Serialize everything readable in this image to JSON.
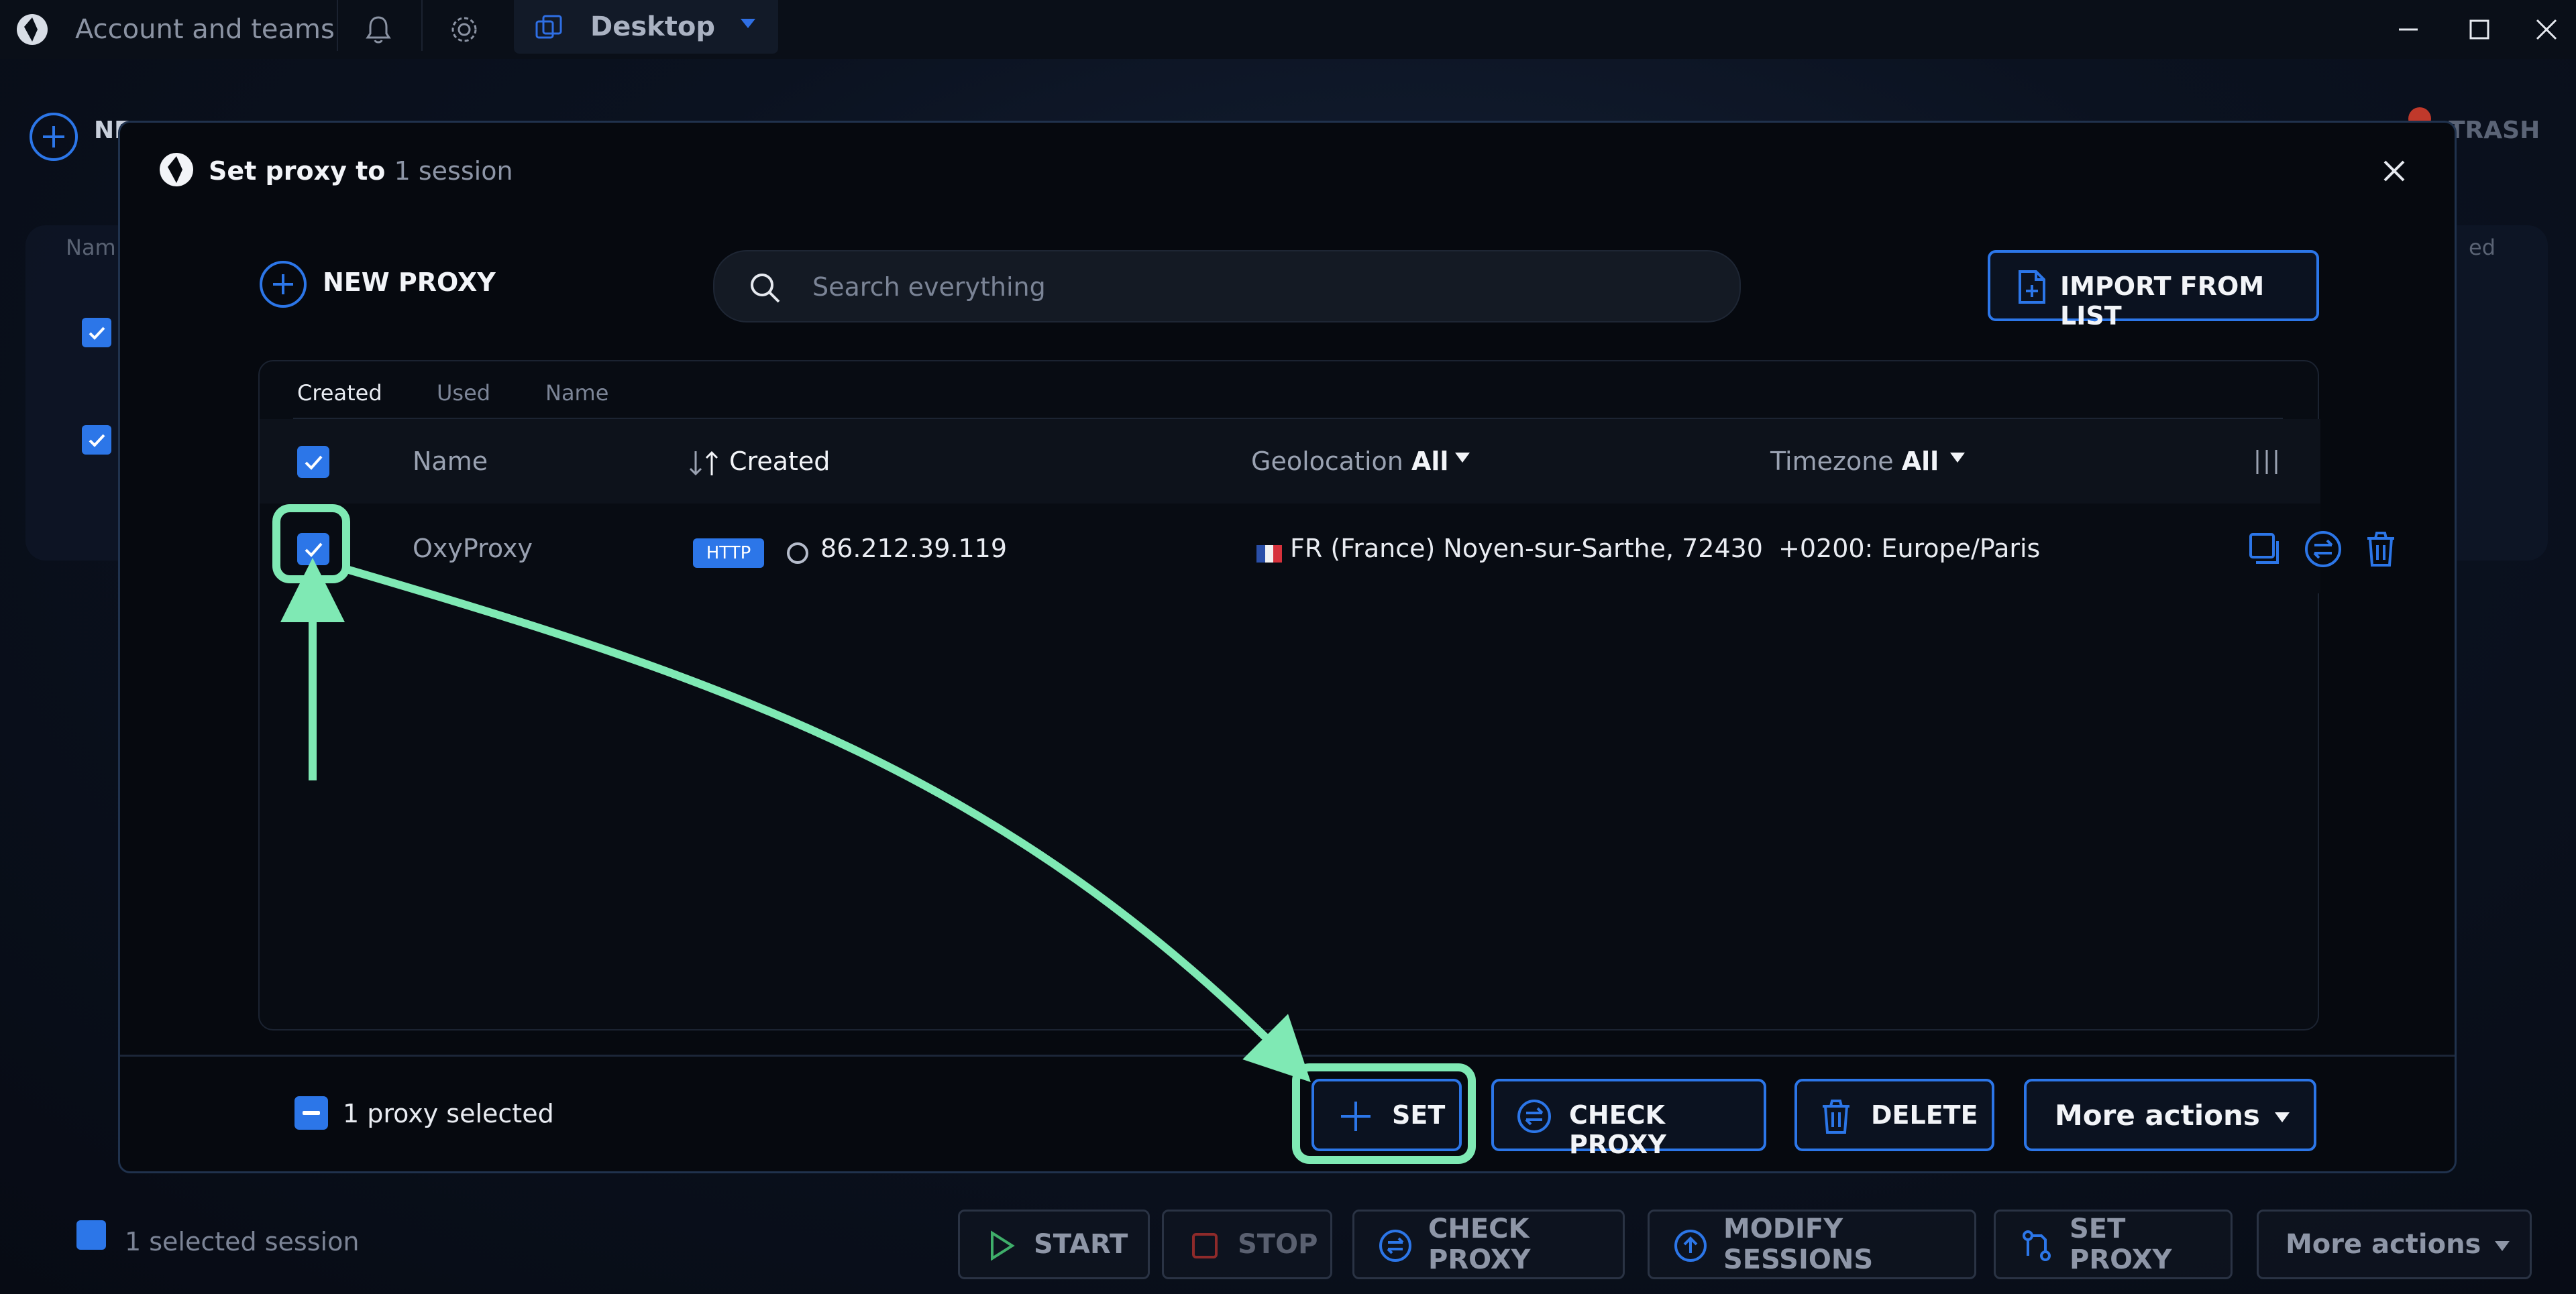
{
  "titlebar": {
    "account_label": "Account and teams",
    "desktop_label": "Desktop"
  },
  "background": {
    "new_label": "NE",
    "trash_label": "TRASH",
    "col_name": "Nam",
    "col_right": "ed",
    "selected_text": "1 selected session",
    "buttons": {
      "start": "START",
      "stop": "STOP",
      "check_proxy": "CHECK PROXY",
      "modify_sessions": "MODIFY SESSIONS",
      "set_proxy": "SET PROXY",
      "more_actions": "More actions"
    }
  },
  "modal": {
    "title_main": "Set proxy to",
    "title_sub": "1 session",
    "new_proxy_label": "NEW PROXY",
    "search_placeholder": "Search everything",
    "import_label": "IMPORT FROM LIST",
    "sort_tabs": [
      "Created",
      "Used",
      "Name"
    ],
    "columns": {
      "name": "Name",
      "created": "Created",
      "geolocation": "Geolocation",
      "geolocation_filter": "All",
      "timezone": "Timezone",
      "timezone_filter": "All"
    },
    "rows": [
      {
        "name": "OxyProxy",
        "protocol": "HTTP",
        "ip": "86.212.39.119",
        "geolocation": "FR (France) Noyen-sur-Sarthe, 72430",
        "timezone": "+0200: Europe/Paris"
      }
    ],
    "footer": {
      "selected_text": "1 proxy selected",
      "set_label": "SET",
      "check_proxy_label": "CHECK PROXY",
      "delete_label": "DELETE",
      "more_actions_label": "More actions"
    }
  },
  "colors": {
    "accent": "#2c76e8",
    "highlight": "#7fe9b4",
    "modal_bg": "#06090f"
  }
}
